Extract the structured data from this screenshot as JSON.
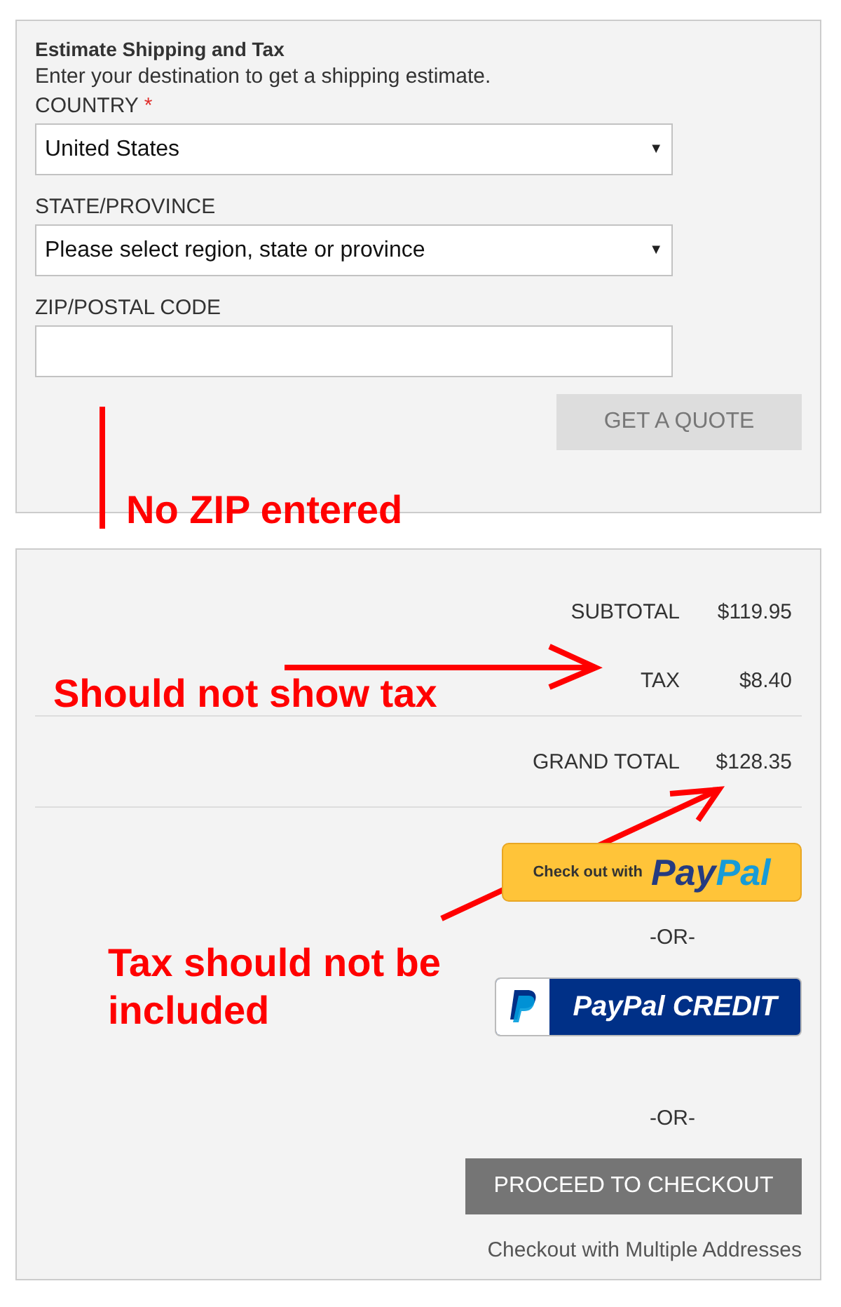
{
  "estimate": {
    "title": "Estimate Shipping and Tax",
    "intro": "Enter your destination to get a shipping estimate.",
    "fields": [
      {
        "kind": "select",
        "label": "COUNTRY",
        "required_mark": "*",
        "value": "United States",
        "arrow": "▼"
      },
      {
        "kind": "select",
        "label": "STATE/PROVINCE",
        "value": "Please select region, state or province",
        "arrow": "▼"
      },
      {
        "kind": "text",
        "label": "ZIP/POSTAL CODE"
      }
    ],
    "quote_button": "GET A QUOTE"
  },
  "totals": {
    "rows": [
      {
        "label": "SUBTOTAL",
        "value": "$119.95"
      },
      {
        "label": "TAX",
        "value": "$8.40"
      },
      {
        "label": "GRAND TOTAL",
        "value": "$128.35"
      }
    ],
    "paypal_button": {
      "prefix": "Check out with",
      "brand_1": "Pay",
      "brand_2": "Pal"
    },
    "separator_1": "-OR-",
    "paypal_credit_button": {
      "label": "PayPal CREDIT"
    },
    "separator_2": "-OR-",
    "checkout_button": "PROCEED TO CHECKOUT",
    "multi_address_link": "Checkout with Multiple Addresses"
  },
  "annotations": [
    {
      "text": "No ZIP entered"
    },
    {
      "text": "Should not show tax"
    },
    {
      "text": "Tax should not be included"
    }
  ]
}
